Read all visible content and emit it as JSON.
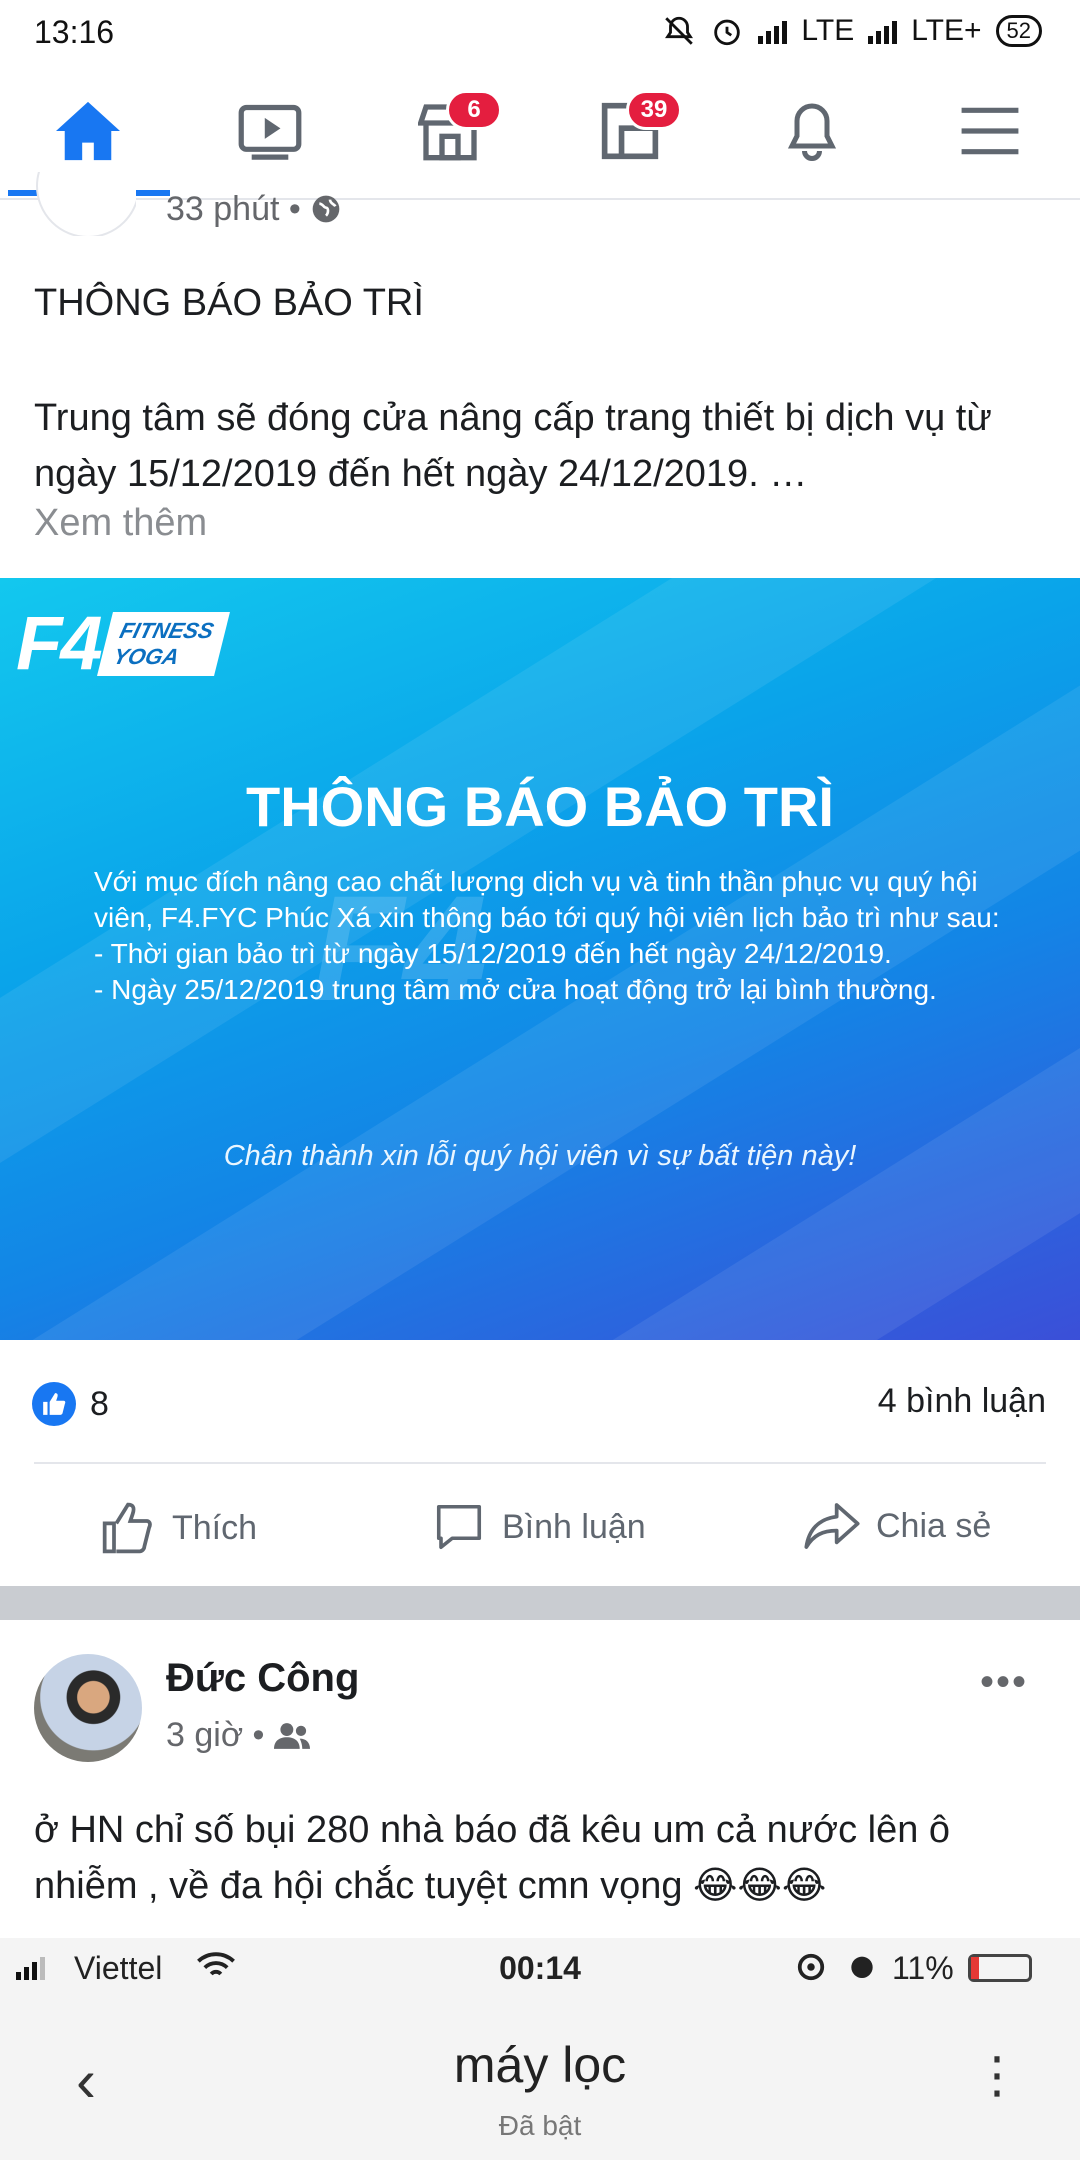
{
  "status_bar": {
    "time": "13:16",
    "network1": "LTE",
    "network2": "LTE+",
    "battery": "52"
  },
  "top_nav": {
    "marketplace_badge": "6",
    "pages_badge": "39",
    "icons": [
      "home-icon",
      "watch-icon",
      "marketplace-icon",
      "pages-icon",
      "bell-icon",
      "menu-icon"
    ],
    "accent": "#1877f2"
  },
  "post1": {
    "time": "33 phút •",
    "title": "THÔNG BÁO BẢO TRÌ",
    "body": "Trung tâm sẽ đóng cửa nâng cấp trang thiết bị dịch vụ từ ngày 15/12/2019 đến hết ngày 24/12/2019. …",
    "see_more": "Xem thêm",
    "image": {
      "logo_main": "F4",
      "logo_line1": "FITNESS",
      "logo_line2": "YOGA",
      "title": "THÔNG BÁO BẢO TRÌ",
      "body": "Với mục đích nâng cao chất lượng dịch vụ và tinh thần phục vụ quý hội viên, F4.FYC Phúc Xá xin thông báo tới quý hội viên lịch bảo trì như sau:\n- Thời gian bảo trì từ ngày 15/12/2019 đến hết ngày 24/12/2019.\n- Ngày 25/12/2019 trung tâm mở cửa hoạt động trở lại bình thường.",
      "footer": "Chân thành xin lỗi quý hội viên vì sự bất tiện này!"
    },
    "likes": "8",
    "comments": "4 bình luận",
    "actions": {
      "like": "Thích",
      "comment": "Bình luận",
      "share": "Chia sẻ"
    }
  },
  "post2": {
    "author": "Đức Công",
    "time": "3 giờ •",
    "text": "ở HN chỉ số bụi 280 nhà báo đã kêu um cả nước lên ô nhiễm , về đa hội chắc tuyệt cmn vọng 😂😂😂",
    "embedded_screenshot": {
      "carrier": "Viettel",
      "time": "00:14",
      "battery": "11%",
      "title": "máy lọc",
      "subtitle": "Đã bật"
    }
  }
}
